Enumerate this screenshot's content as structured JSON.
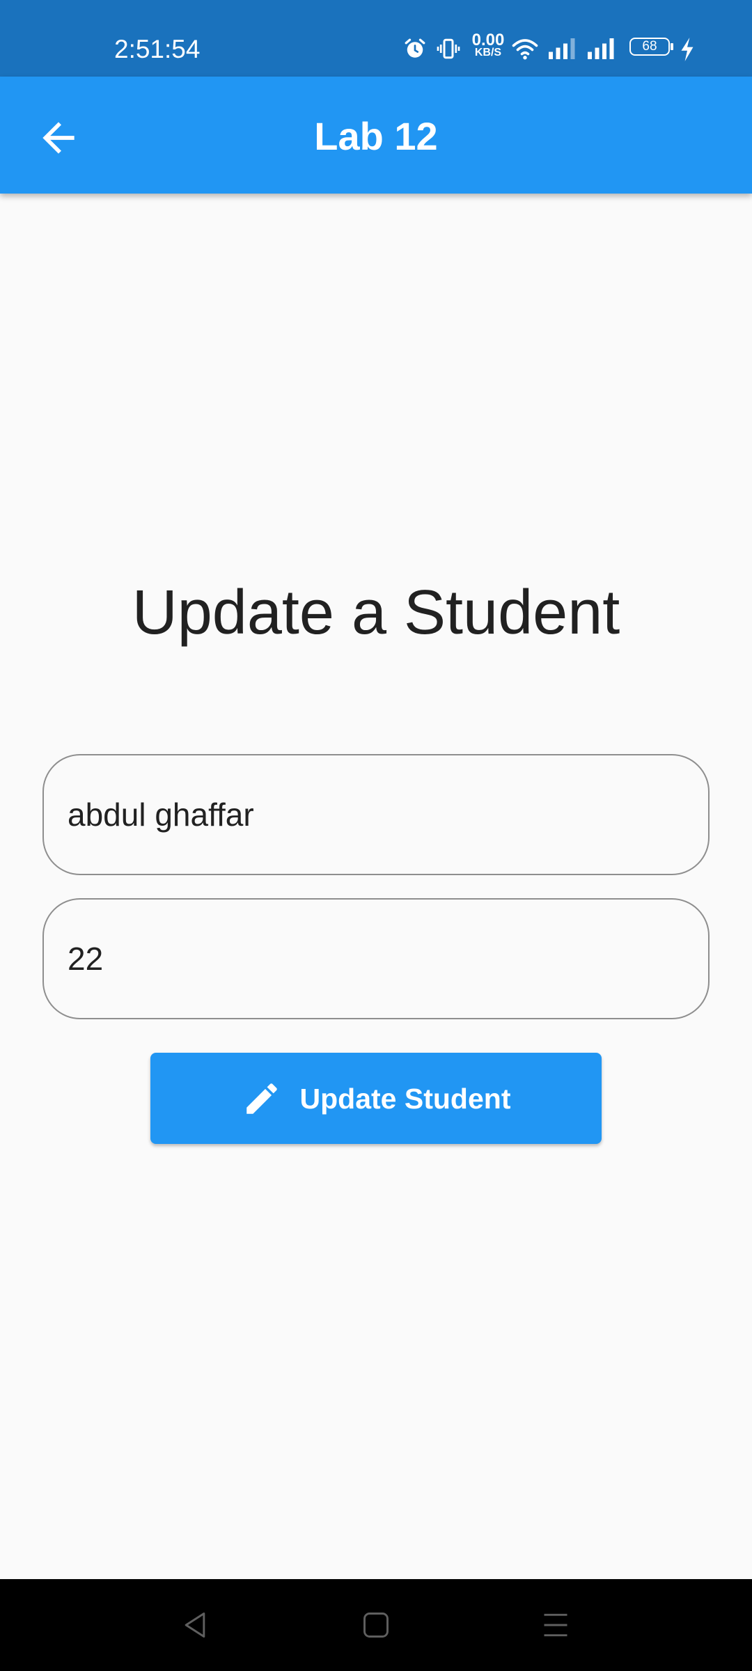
{
  "status_bar": {
    "time": "2:51:54",
    "net_speed_value": "0.00",
    "net_speed_unit": "KB/S",
    "battery_level": "68",
    "icons": [
      "alarm-icon",
      "vibrate-icon",
      "wifi-icon",
      "signal-icon",
      "signal-icon",
      "battery-icon",
      "charging-icon"
    ]
  },
  "app_bar": {
    "title": "Lab 12",
    "back_icon": "arrow-back-icon"
  },
  "page": {
    "title": "Update a Student"
  },
  "form": {
    "name_value": "abdul ghaffar",
    "age_value": "22"
  },
  "button": {
    "label": "Update Student",
    "icon": "pencil-icon"
  },
  "nav_bar": {
    "icons": [
      "nav-back-icon",
      "nav-home-icon",
      "nav-menu-icon"
    ]
  },
  "colors": {
    "status_bar": "#1a72bd",
    "primary": "#2196f3",
    "background": "#fafafa",
    "text": "#212121",
    "field_border": "#8e8e8e",
    "nav_bar": "#000000"
  }
}
